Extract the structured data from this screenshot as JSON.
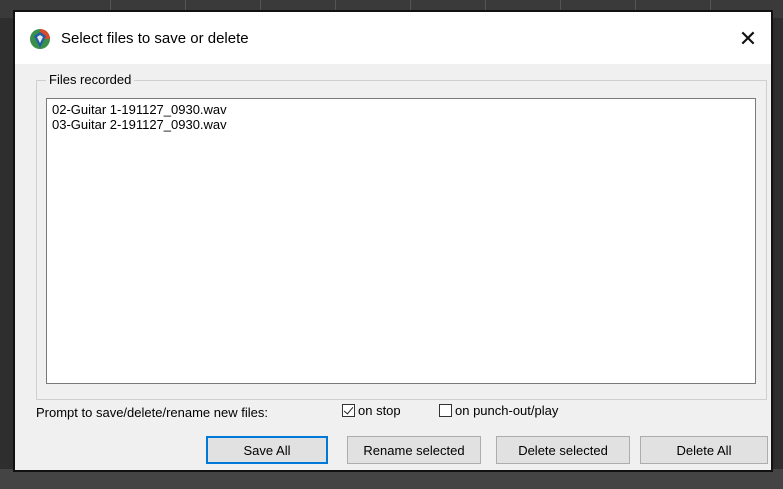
{
  "dialog": {
    "title": "Select files to save or delete",
    "close_glyph": "✕",
    "icon": "reaper-app-icon"
  },
  "group": {
    "label": "Files recorded"
  },
  "files": [
    "02-Guitar 1-191127_0930.wav",
    "03-Guitar 2-191127_0930.wav"
  ],
  "prompt": {
    "label": "Prompt to save/delete/rename new files:",
    "on_stop": {
      "label": "on stop",
      "checked": true
    },
    "on_punch": {
      "label": "on punch-out/play",
      "checked": false
    }
  },
  "buttons": {
    "save_all": "Save All",
    "rename_selected": "Rename selected",
    "delete_selected": "Delete selected",
    "delete_all": "Delete All"
  },
  "colors": {
    "default_button_border": "#0078d7",
    "dialog_bg": "#f0f0f0"
  }
}
